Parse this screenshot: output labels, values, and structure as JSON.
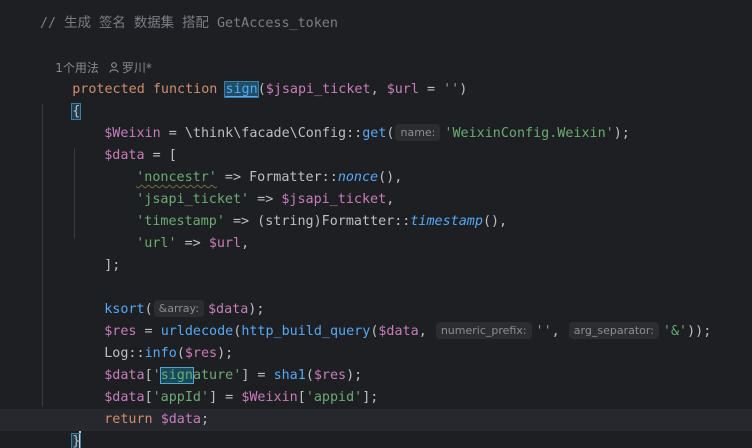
{
  "comment": "// 生成 签名 数据集 搭配 GetAccess_token",
  "usage": {
    "count": "1个用法",
    "author_icon": "person-icon",
    "author": "罗川*"
  },
  "code": {
    "kw_protected": "protected",
    "kw_function": "function",
    "fn_name": "sign",
    "sig_open": "(",
    "param1": "$jsapi_ticket",
    "comma_sp": ", ",
    "param2": "$url",
    "eq_default": " = ",
    "empty_str": "''",
    "sig_close": ")",
    "open_brace": "{",
    "close_brace": "}",
    "l3_var": "$Weixin",
    "l3_eq": " = \\think\\facade\\Config::",
    "l3_get": "get",
    "l3_open": "(",
    "l3_hint": "name:",
    "l3_str": "'WeixinConfig.Weixin'",
    "l3_close": ");",
    "l4_var": "$data",
    "l4_rest": " = [",
    "l5_key": "'noncestr'",
    "l5_arrow": " => Formatter::",
    "l5_fn": "nonce",
    "l5_end": "(),",
    "l6_key": "'jsapi_ticket'",
    "l6_arrow": " => ",
    "l6_var": "$jsapi_ticket",
    "l6_end": ",",
    "l7_key": "'timestamp'",
    "l7_arrow": " => (string)Formatter::",
    "l7_fn": "timestamp",
    "l7_end": "(),",
    "l8_key": "'url'",
    "l8_arrow": " => ",
    "l8_var": "$url",
    "l8_end": ",",
    "l9": "];",
    "l11_fn": "ksort",
    "l11_open": "(",
    "l11_hint": "&array:",
    "l11_var": "$data",
    "l11_end": ");",
    "l12_var": "$res",
    "l12_eq": " = ",
    "l12_fn1": "urldecode",
    "l12_open1": "(",
    "l12_fn2": "http_build_query",
    "l12_open2": "(",
    "l12_var2": "$data",
    "l12_comma1": ", ",
    "l12_hint1": "numeric_prefix:",
    "l12_str1": "''",
    "l12_comma2": ", ",
    "l12_hint2": "arg_separator:",
    "l12_str2": "'&'",
    "l12_end": "));",
    "l13_cls": "Log::",
    "l13_fn": "info",
    "l13_open": "(",
    "l13_var": "$res",
    "l13_end": ");",
    "l14_var": "$data",
    "l14_open": "[",
    "l14_q": "'",
    "l14_key_hl": "sign",
    "l14_key_rest": "ature'",
    "l14_mid": "] = ",
    "l14_fn": "sha1",
    "l14_open2": "(",
    "l14_var2": "$res",
    "l14_end": ");",
    "l15_var": "$data",
    "l15_open": "[",
    "l15_key": "'appId'",
    "l15_mid": "] = ",
    "l15_var2": "$Weixin",
    "l15_open2": "[",
    "l15_key2": "'appid'",
    "l15_end": "];",
    "l16_kw": "return",
    "l16_sp": " ",
    "l16_var": "$data",
    "l16_end": ";"
  },
  "colors": {
    "background": "#1e1f22",
    "keyword": "#cf8e6d",
    "function": "#56a8f5",
    "variable": "#c77dbb",
    "string": "#6aab73",
    "comment": "#7a7e85"
  }
}
